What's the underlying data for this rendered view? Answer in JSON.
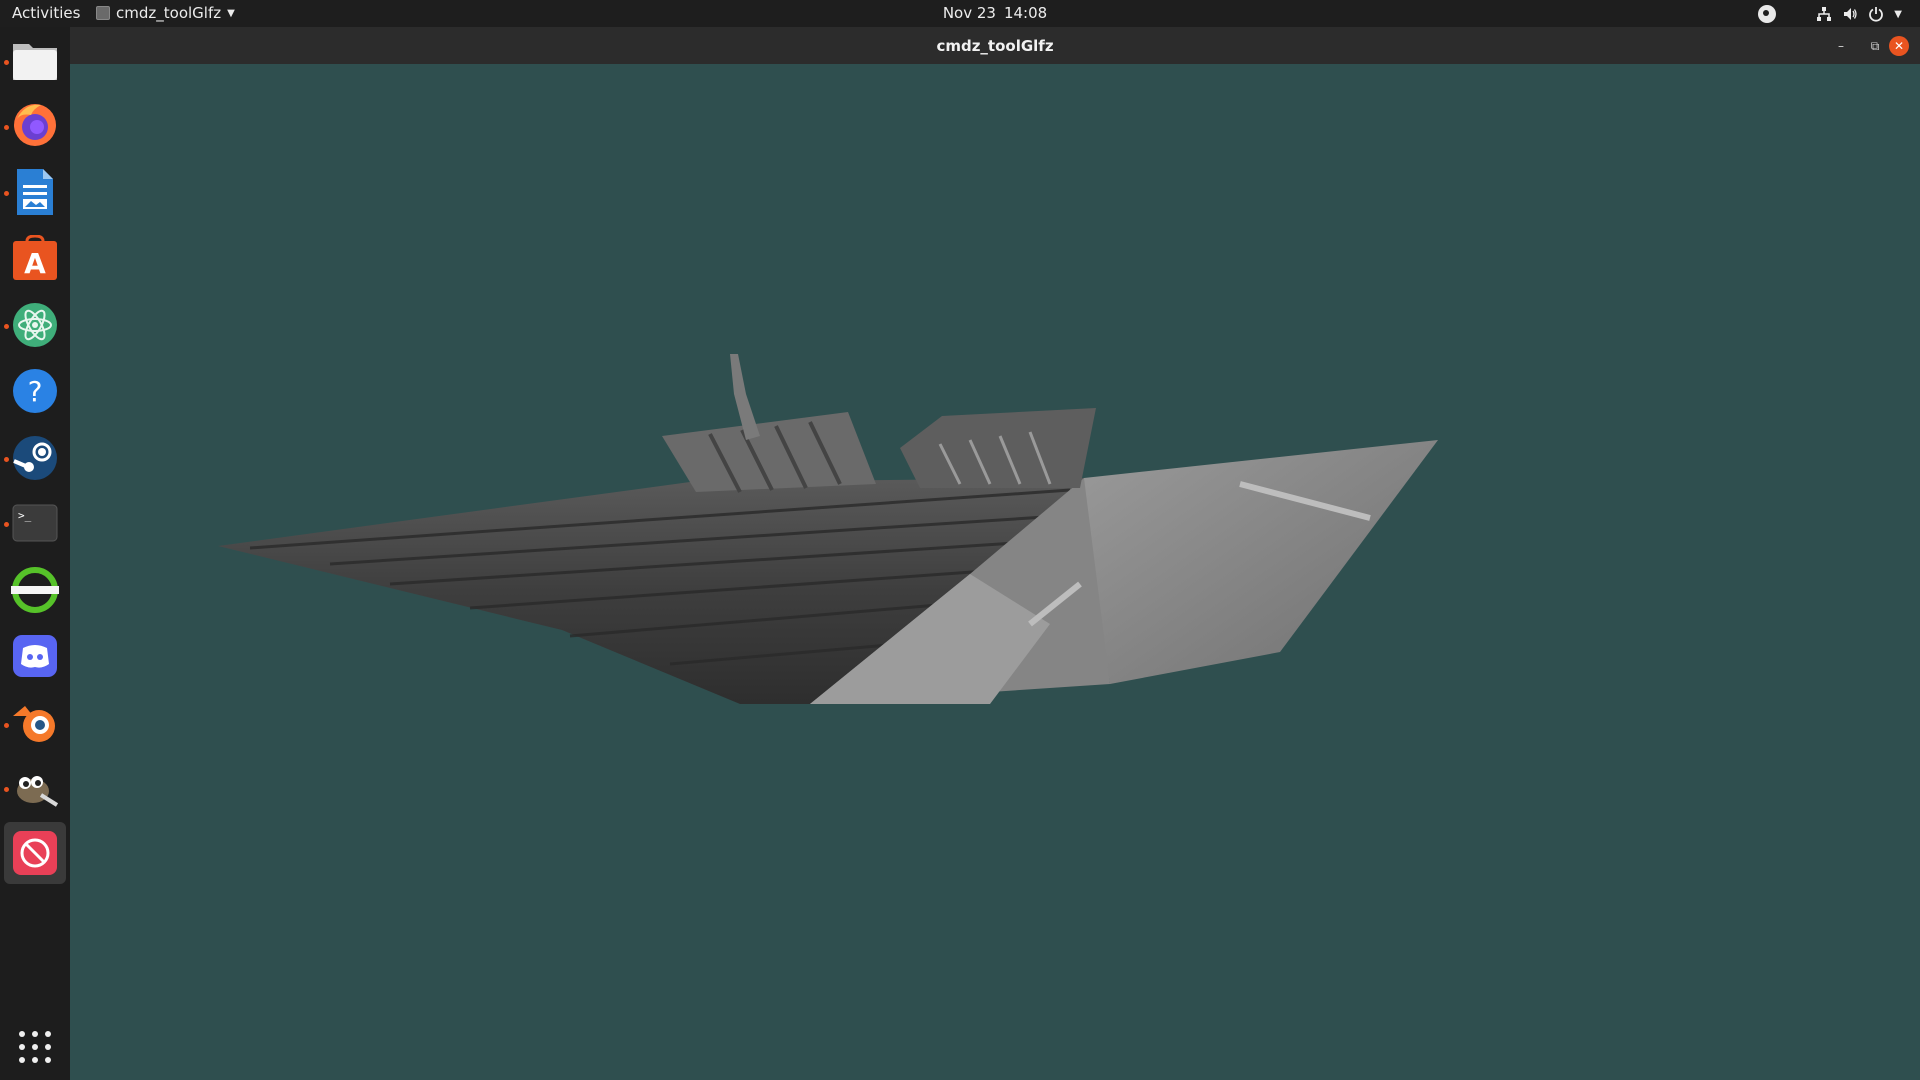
{
  "topbar": {
    "activities": "Activities",
    "app_name": "cmdz_toolGlfz",
    "date": "Nov 23",
    "time": "14:08"
  },
  "window": {
    "title": "cmdz_toolGlfz",
    "minimize_icon": "minimize-icon",
    "restore_icon": "restore-icon",
    "close_icon": "close-icon"
  },
  "dock": {
    "items": [
      {
        "name": "files",
        "icon": "files-icon",
        "running": true
      },
      {
        "name": "firefox",
        "icon": "firefox-icon",
        "running": true
      },
      {
        "name": "libreoffice-writer",
        "icon": "writer-icon",
        "running": true
      },
      {
        "name": "ubuntu-software",
        "icon": "software-icon",
        "running": false
      },
      {
        "name": "atom",
        "icon": "atom-icon",
        "running": true
      },
      {
        "name": "help",
        "icon": "help-icon",
        "running": false
      },
      {
        "name": "steam",
        "icon": "steam-icon",
        "running": true
      },
      {
        "name": "terminal",
        "icon": "terminal-icon",
        "running": true
      },
      {
        "name": "app-green",
        "icon": "ring-icon",
        "running": false
      },
      {
        "name": "discord",
        "icon": "discord-icon",
        "running": false
      },
      {
        "name": "blender",
        "icon": "blender-icon",
        "running": true
      },
      {
        "name": "gimp",
        "icon": "gimp-icon",
        "running": true
      },
      {
        "name": "cmdz-toolglfz",
        "icon": "no-entry-icon",
        "running": true,
        "active": true
      }
    ],
    "show_apps_icon": "app-grid-icon"
  },
  "colors": {
    "accent": "#e95420",
    "viewport_bg": "#2f4f4f",
    "panel_bg": "#1e1e1e"
  }
}
